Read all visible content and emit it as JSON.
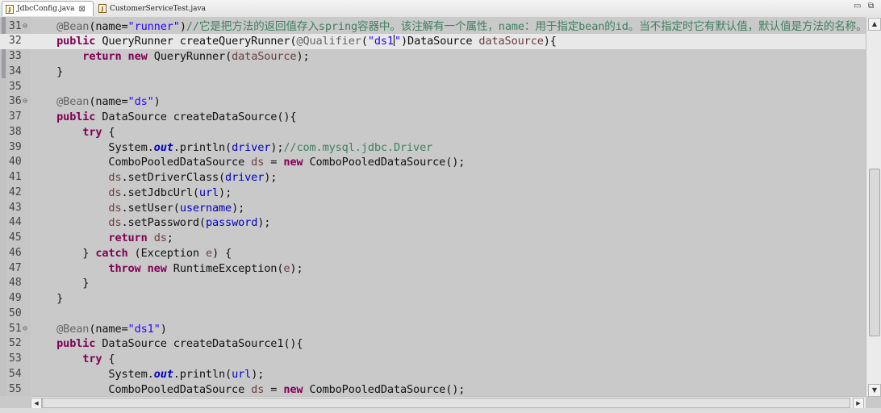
{
  "tabs": [
    {
      "label": "JdbcConfig.java",
      "icon": "java-file-icon",
      "active": true
    },
    {
      "label": "CustomerServiceTest.java",
      "icon": "java-file-icon",
      "active": false
    }
  ],
  "window_controls": {
    "minimize": "▭",
    "restore": "⧉"
  },
  "lines": [
    {
      "n": "31",
      "fold": "⊖",
      "tokens": [
        [
          "",
          "    "
        ],
        [
          "ann",
          "@Bean"
        ],
        [
          "",
          "(name="
        ],
        [
          "str",
          "\"runner\""
        ],
        [
          "",
          ")"
        ],
        [
          "cm",
          "//它是把方法的返回值存入spring容器中。该注解有一个属性，name：用于指定bean的id。当不指定时它有默认值，默认值是方法的名称。"
        ]
      ]
    },
    {
      "n": "32",
      "current": true,
      "tokens": [
        [
          "",
          "    "
        ],
        [
          "kw",
          "public"
        ],
        [
          "",
          " QueryRunner createQueryRunner("
        ],
        [
          "ann",
          "@Qualifier"
        ],
        [
          "",
          "("
        ],
        [
          "str",
          "\"ds1"
        ],
        [
          "caret",
          ""
        ],
        [
          "str",
          "\""
        ],
        [
          "",
          ")DataSource "
        ],
        [
          "var",
          "dataSource"
        ],
        [
          "",
          "){"
        ]
      ]
    },
    {
      "n": "33",
      "tokens": [
        [
          "",
          "        "
        ],
        [
          "kw",
          "return"
        ],
        [
          "",
          " "
        ],
        [
          "kw",
          "new"
        ],
        [
          "",
          " QueryRunner("
        ],
        [
          "var",
          "dataSource"
        ],
        [
          "",
          ");"
        ]
      ]
    },
    {
      "n": "34",
      "tokens": [
        [
          "",
          "    }"
        ]
      ]
    },
    {
      "n": "35",
      "tokens": [
        [
          "",
          ""
        ]
      ]
    },
    {
      "n": "36",
      "fold": "⊖",
      "tokens": [
        [
          "",
          "    "
        ],
        [
          "ann",
          "@Bean"
        ],
        [
          "",
          "(name="
        ],
        [
          "str",
          "\"ds\""
        ],
        [
          "",
          ")"
        ]
      ]
    },
    {
      "n": "37",
      "tokens": [
        [
          "",
          "    "
        ],
        [
          "kw",
          "public"
        ],
        [
          "",
          " DataSource createDataSource(){"
        ]
      ]
    },
    {
      "n": "38",
      "tokens": [
        [
          "",
          "        "
        ],
        [
          "kw",
          "try"
        ],
        [
          "",
          " {"
        ]
      ]
    },
    {
      "n": "39",
      "tokens": [
        [
          "",
          "            System."
        ],
        [
          "sfld",
          "out"
        ],
        [
          "",
          ".println("
        ],
        [
          "fld",
          "driver"
        ],
        [
          "",
          ");"
        ],
        [
          "cm",
          "//com.mysql.jdbc.Driver"
        ]
      ]
    },
    {
      "n": "40",
      "tokens": [
        [
          "",
          "            ComboPooledDataSource "
        ],
        [
          "var",
          "ds"
        ],
        [
          "",
          " = "
        ],
        [
          "kw",
          "new"
        ],
        [
          "",
          " ComboPooledDataSource();"
        ]
      ]
    },
    {
      "n": "41",
      "tokens": [
        [
          "",
          "            "
        ],
        [
          "var",
          "ds"
        ],
        [
          "",
          ".setDriverClass("
        ],
        [
          "fld",
          "driver"
        ],
        [
          "",
          ");"
        ]
      ]
    },
    {
      "n": "42",
      "tokens": [
        [
          "",
          "            "
        ],
        [
          "var",
          "ds"
        ],
        [
          "",
          ".setJdbcUrl("
        ],
        [
          "fld",
          "url"
        ],
        [
          "",
          ");"
        ]
      ]
    },
    {
      "n": "43",
      "tokens": [
        [
          "",
          "            "
        ],
        [
          "var",
          "ds"
        ],
        [
          "",
          ".setUser("
        ],
        [
          "fld",
          "username"
        ],
        [
          "",
          ");"
        ]
      ]
    },
    {
      "n": "44",
      "tokens": [
        [
          "",
          "            "
        ],
        [
          "var",
          "ds"
        ],
        [
          "",
          ".setPassword("
        ],
        [
          "fld",
          "password"
        ],
        [
          "",
          ");"
        ]
      ]
    },
    {
      "n": "45",
      "tokens": [
        [
          "",
          "            "
        ],
        [
          "kw",
          "return"
        ],
        [
          "",
          " "
        ],
        [
          "var",
          "ds"
        ],
        [
          "",
          ";"
        ]
      ]
    },
    {
      "n": "46",
      "tokens": [
        [
          "",
          "        } "
        ],
        [
          "kw",
          "catch"
        ],
        [
          "",
          " (Exception "
        ],
        [
          "var",
          "e"
        ],
        [
          "",
          ") {"
        ]
      ]
    },
    {
      "n": "47",
      "tokens": [
        [
          "",
          "            "
        ],
        [
          "kw",
          "throw"
        ],
        [
          "",
          " "
        ],
        [
          "kw",
          "new"
        ],
        [
          "",
          " RuntimeException("
        ],
        [
          "var",
          "e"
        ],
        [
          "",
          ");"
        ]
      ]
    },
    {
      "n": "48",
      "tokens": [
        [
          "",
          "        }"
        ]
      ]
    },
    {
      "n": "49",
      "tokens": [
        [
          "",
          "    }"
        ]
      ]
    },
    {
      "n": "50",
      "tokens": [
        [
          "",
          ""
        ]
      ]
    },
    {
      "n": "51",
      "fold": "⊖",
      "tokens": [
        [
          "",
          "    "
        ],
        [
          "ann",
          "@Bean"
        ],
        [
          "",
          "(name="
        ],
        [
          "str",
          "\"ds1\""
        ],
        [
          "",
          ")"
        ]
      ]
    },
    {
      "n": "52",
      "tokens": [
        [
          "",
          "    "
        ],
        [
          "kw",
          "public"
        ],
        [
          "",
          " DataSource createDataSource1(){"
        ]
      ]
    },
    {
      "n": "53",
      "tokens": [
        [
          "",
          "        "
        ],
        [
          "kw",
          "try"
        ],
        [
          "",
          " {"
        ]
      ]
    },
    {
      "n": "54",
      "tokens": [
        [
          "",
          "            System."
        ],
        [
          "sfld",
          "out"
        ],
        [
          "",
          ".println("
        ],
        [
          "fld",
          "url"
        ],
        [
          "",
          ");"
        ]
      ]
    },
    {
      "n": "55",
      "tokens": [
        [
          "",
          "            ComboPooledDataSource "
        ],
        [
          "var",
          "ds"
        ],
        [
          "",
          " = "
        ],
        [
          "kw",
          "new"
        ],
        [
          "",
          " ComboPooledDataSource();"
        ]
      ]
    }
  ],
  "colors": {
    "keyword": "#7f0055",
    "string": "#2a00ff",
    "comment": "#3f7f5f",
    "annotation": "#646464",
    "field": "#0000c0",
    "local": "#6a3e3e",
    "editor_bg": "#c9c9c9",
    "current_line": "#e8e8e8"
  },
  "scrollbar": {
    "up": "▲",
    "down": "▼",
    "left": "◀",
    "right": "▶"
  }
}
